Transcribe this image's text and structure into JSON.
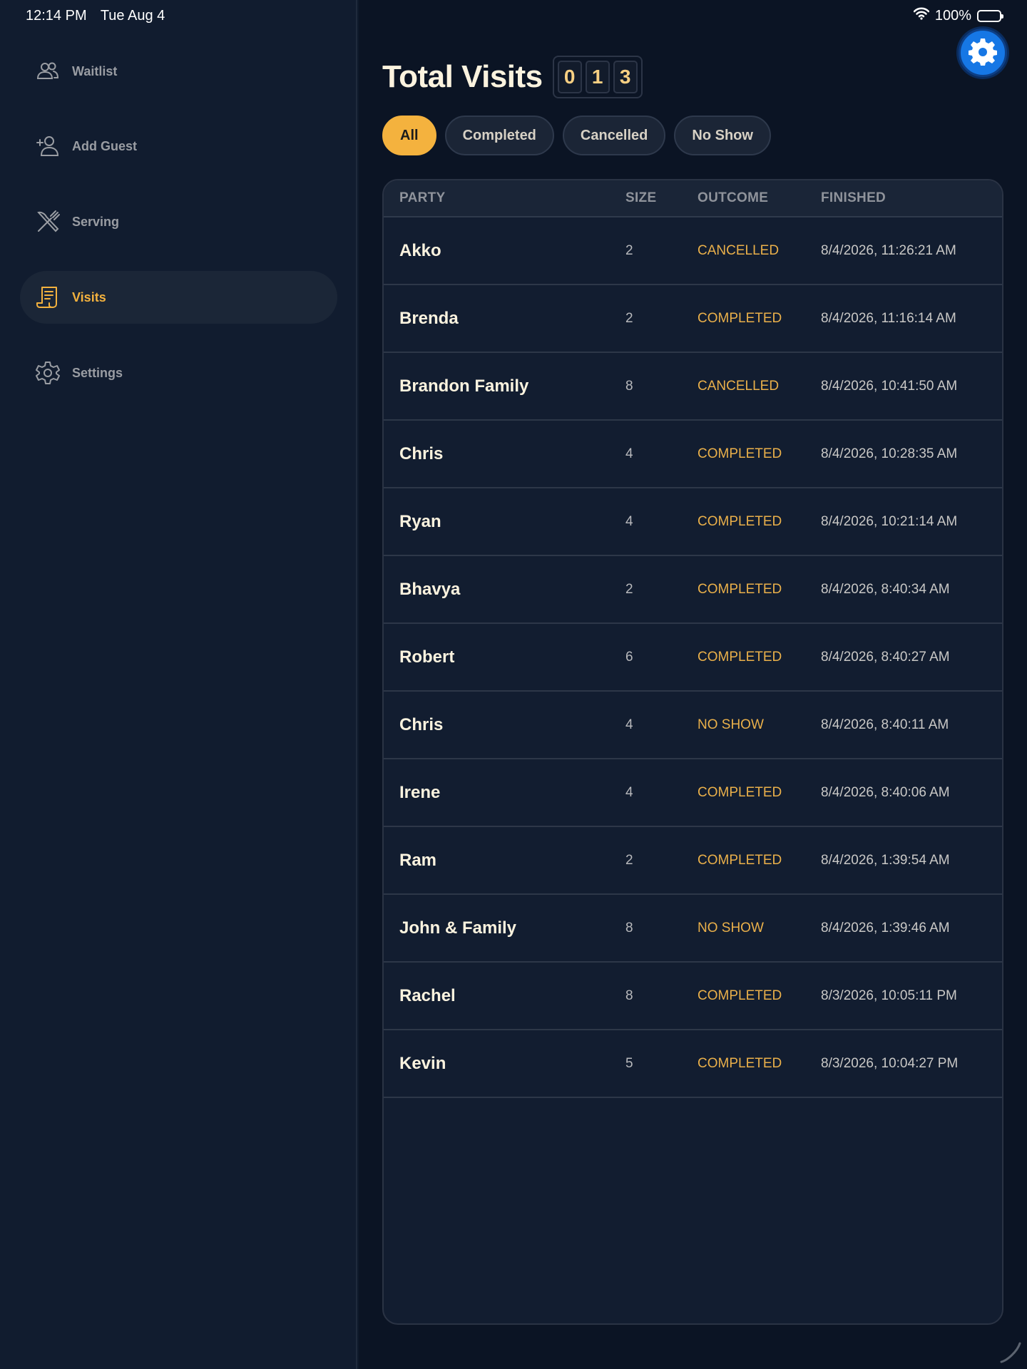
{
  "status_bar": {
    "time": "12:14 PM",
    "date": "Tue Aug 4",
    "battery_percent": "100%",
    "battery_level": 1.0
  },
  "sidebar": {
    "items": [
      {
        "label": "Waitlist",
        "icon": "people-icon",
        "active": false
      },
      {
        "label": "Add Guest",
        "icon": "add-person-icon",
        "active": false
      },
      {
        "label": "Serving",
        "icon": "utensils-icon",
        "active": false
      },
      {
        "label": "Visits",
        "icon": "receipt-icon",
        "active": true
      },
      {
        "label": "Settings",
        "icon": "gear-icon",
        "active": false
      }
    ]
  },
  "header": {
    "title": "Total Visits",
    "count_digits": [
      "0",
      "1",
      "3"
    ]
  },
  "filters": [
    {
      "label": "All",
      "active": true
    },
    {
      "label": "Completed",
      "active": false
    },
    {
      "label": "Cancelled",
      "active": false
    },
    {
      "label": "No Show",
      "active": false
    }
  ],
  "table": {
    "columns": [
      "PARTY",
      "SIZE",
      "OUTCOME",
      "FINISHED"
    ],
    "rows": [
      {
        "party": "Akko",
        "size": "2",
        "outcome": "CANCELLED",
        "finished": "8/4/2026, 11:26:21 AM"
      },
      {
        "party": "Brenda",
        "size": "2",
        "outcome": "COMPLETED",
        "finished": "8/4/2026, 11:16:14 AM"
      },
      {
        "party": "Brandon Family",
        "size": "8",
        "outcome": "CANCELLED",
        "finished": "8/4/2026, 10:41:50 AM"
      },
      {
        "party": "Chris",
        "size": "4",
        "outcome": "COMPLETED",
        "finished": "8/4/2026, 10:28:35 AM"
      },
      {
        "party": "Ryan",
        "size": "4",
        "outcome": "COMPLETED",
        "finished": "8/4/2026, 10:21:14 AM"
      },
      {
        "party": "Bhavya",
        "size": "2",
        "outcome": "COMPLETED",
        "finished": "8/4/2026, 8:40:34 AM"
      },
      {
        "party": "Robert",
        "size": "6",
        "outcome": "COMPLETED",
        "finished": "8/4/2026, 8:40:27 AM"
      },
      {
        "party": "Chris",
        "size": "4",
        "outcome": "NO SHOW",
        "finished": "8/4/2026, 8:40:11 AM"
      },
      {
        "party": "Irene",
        "size": "4",
        "outcome": "COMPLETED",
        "finished": "8/4/2026, 8:40:06 AM"
      },
      {
        "party": "Ram",
        "size": "2",
        "outcome": "COMPLETED",
        "finished": "8/4/2026, 1:39:54 AM"
      },
      {
        "party": "John & Family",
        "size": "8",
        "outcome": "NO SHOW",
        "finished": "8/4/2026, 1:39:46 AM"
      },
      {
        "party": "Rachel",
        "size": "8",
        "outcome": "COMPLETED",
        "finished": "8/3/2026, 10:05:11 PM"
      },
      {
        "party": "Kevin",
        "size": "5",
        "outcome": "COMPLETED",
        "finished": "8/3/2026, 10:04:27 PM"
      }
    ]
  },
  "colors": {
    "accent": "#f4b23e",
    "sidebar_bg": "#111c2f",
    "main_bg": "#0b1424",
    "settings_button": "#1677e5"
  }
}
